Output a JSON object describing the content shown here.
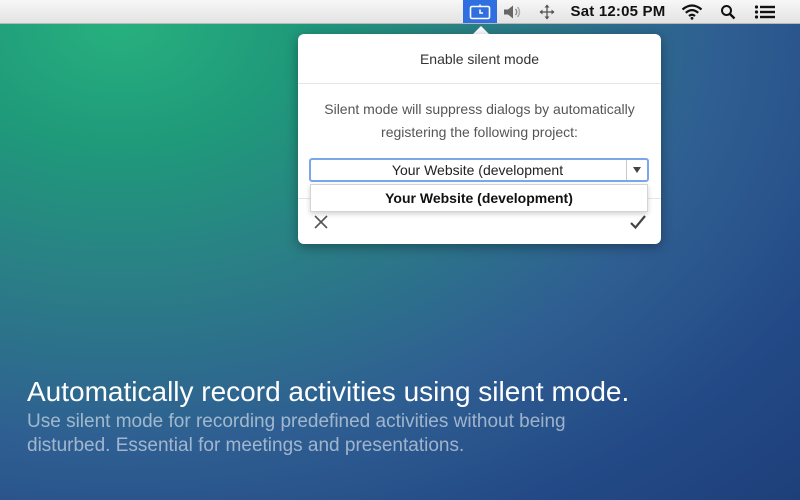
{
  "menubar": {
    "clock": "Sat 12:05 PM",
    "icons": [
      "timer-app-icon",
      "volume-icon",
      "move-icon",
      "wifi-icon",
      "spotlight-search-icon",
      "notification-list-icon"
    ],
    "active_color": "#2f6fe0"
  },
  "popover": {
    "title": "Enable silent mode",
    "message": "Silent mode will suppress dialogs by automatically registering the following project:",
    "select_value": "Your Website (development",
    "dropdown_options": [
      "Your Website (development)"
    ],
    "cancel_icon": "close-icon",
    "confirm_icon": "checkmark-icon"
  },
  "caption": {
    "headline": "Automatically record activities using silent mode.",
    "subline": "Use silent mode for recording predefined activities without being disturbed. Essential for meetings and presentations."
  }
}
